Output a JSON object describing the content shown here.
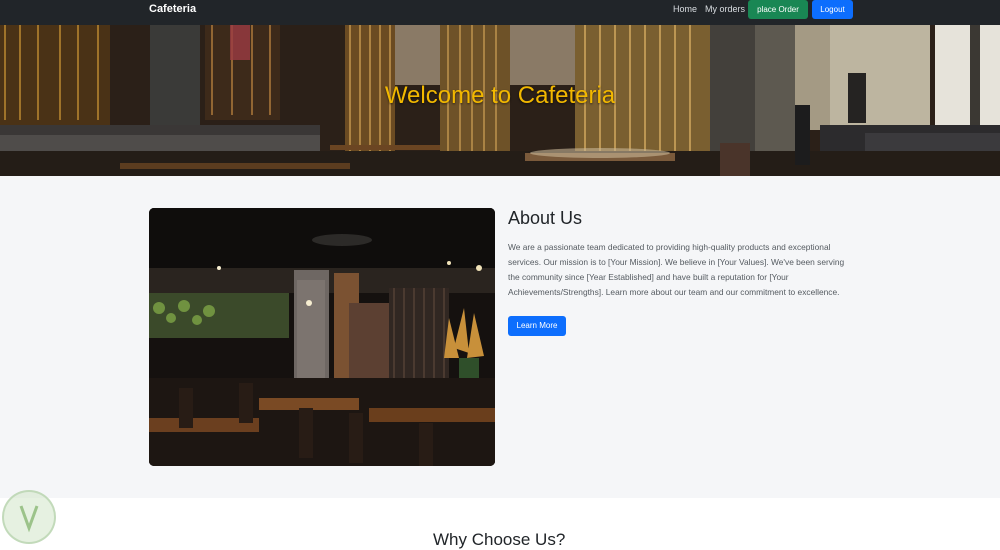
{
  "navbar": {
    "brand": "Cafeteria",
    "links": [
      "Home",
      "My orders"
    ],
    "place_order_label": "place Order",
    "logout_label": "Logout"
  },
  "hero": {
    "title": "Welcome to Cafeteria"
  },
  "about": {
    "heading": "About Us",
    "text": "We are a passionate team dedicated to providing high-quality products and exceptional services. Our mission is to [Your Mission]. We believe in [Your Values]. We've been serving the community since [Year Established] and have built a reputation for [Your Achievements/Strengths]. Learn more about our team and our commitment to excellence.",
    "button_label": "Learn More"
  },
  "why": {
    "heading": "Why Choose Us?"
  },
  "colors": {
    "navbar_bg": "#212529",
    "hero_title": "#f2b800",
    "place_order": "#198754",
    "primary": "#0d6efd",
    "section_bg": "#f5f6f8"
  }
}
